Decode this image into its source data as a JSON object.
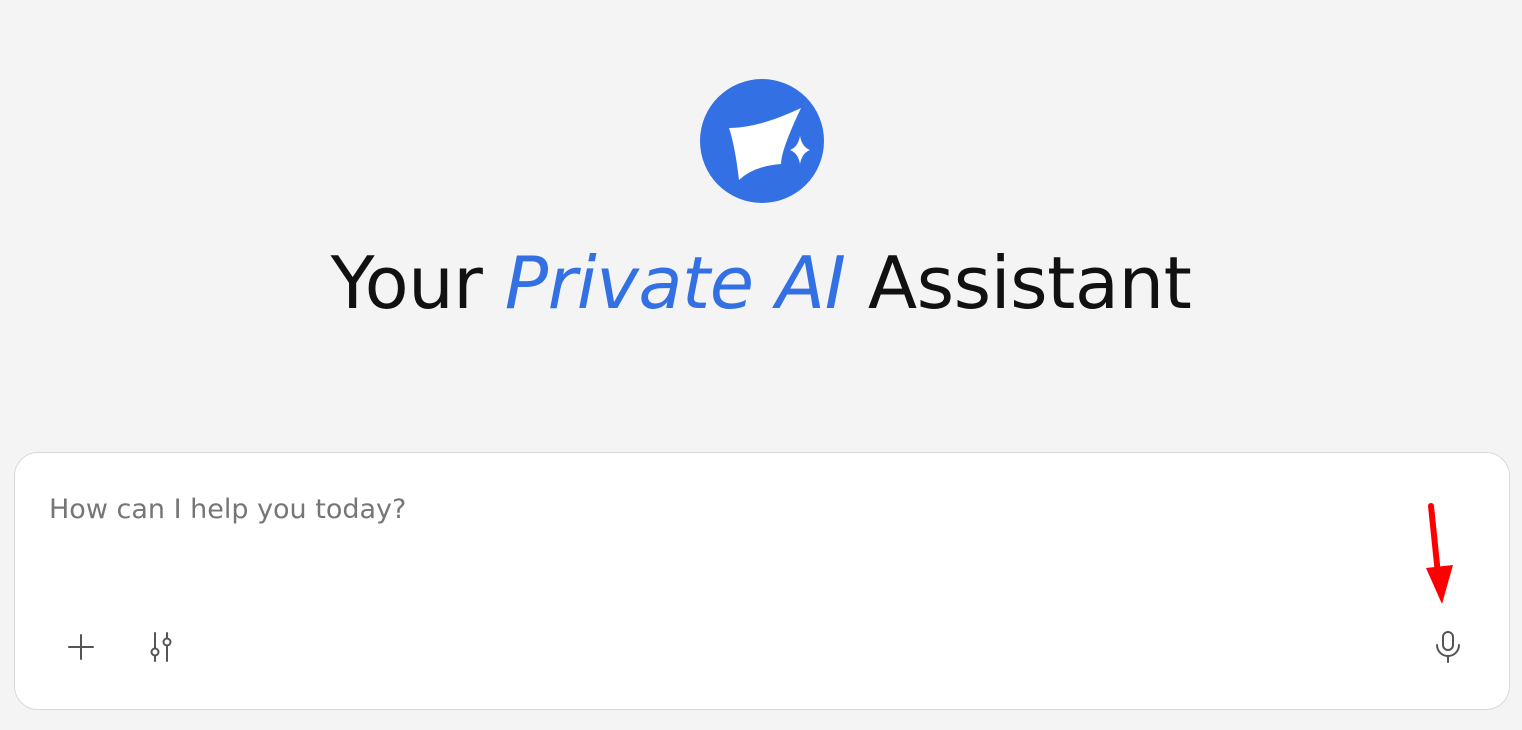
{
  "brand": {
    "logo_icon": "sparkle-logo-icon",
    "accent_color": "#3370e4"
  },
  "hero": {
    "title_prefix": "Your",
    "title_highlight": "Private AI",
    "title_suffix": "Assistant"
  },
  "composer": {
    "placeholder": "How can I help you today?",
    "value": "",
    "icons": {
      "add": "plus-icon",
      "tools": "sliders-icon",
      "voice": "microphone-icon"
    }
  },
  "annotation": {
    "icon": "red-arrow-down-icon",
    "color": "#ff0000"
  }
}
